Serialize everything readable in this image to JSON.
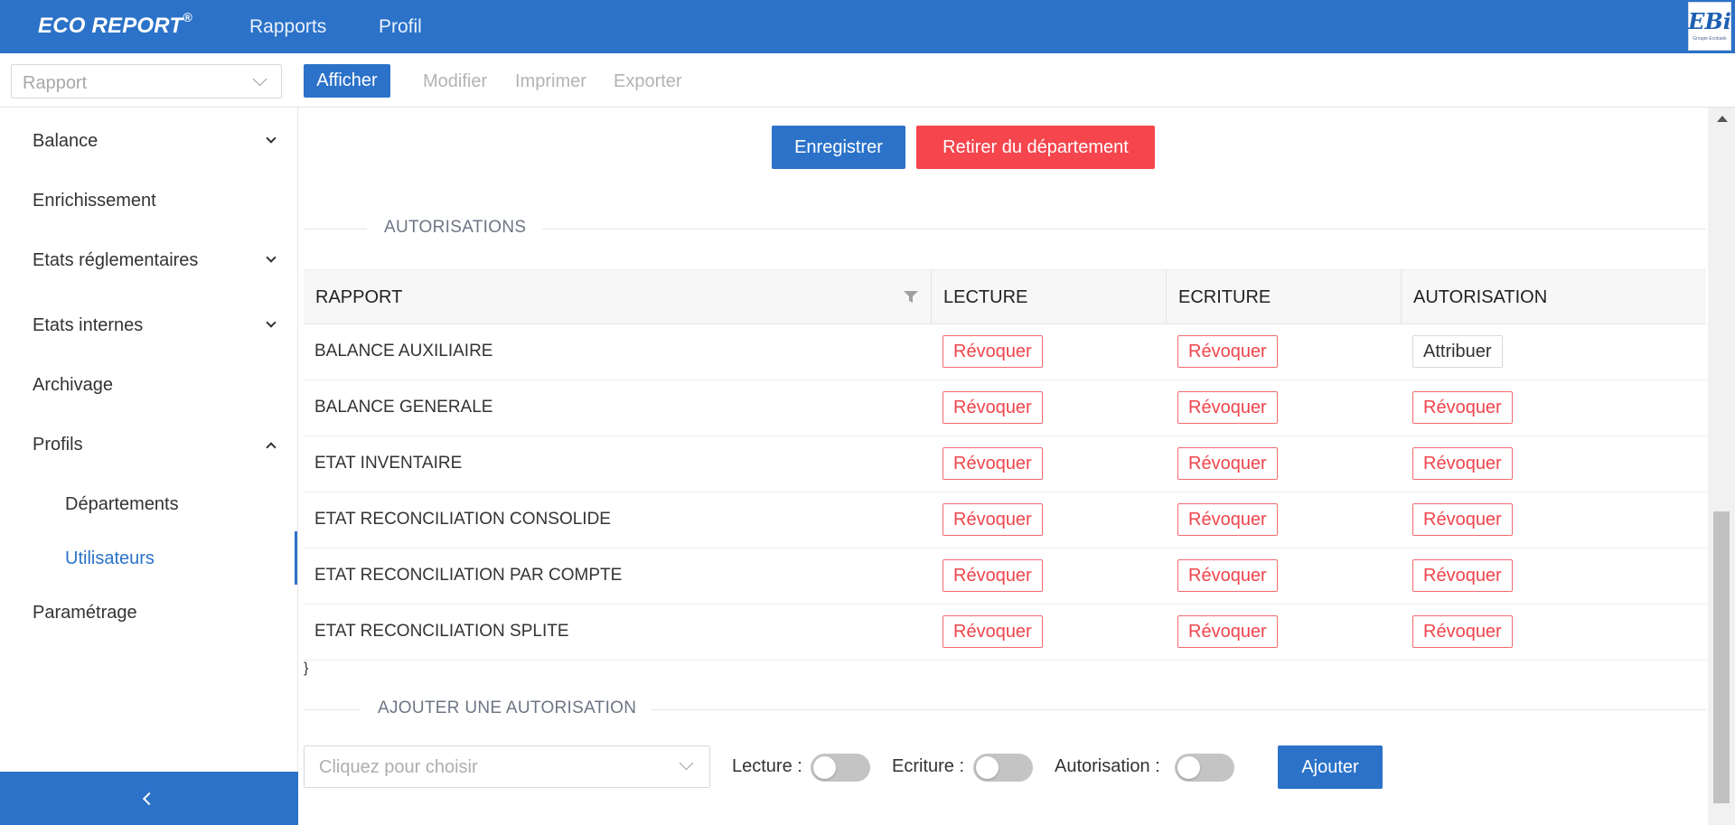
{
  "header": {
    "brand": "ECO REPORT",
    "brand_mark": "®",
    "nav": [
      "Rapports",
      "Profil"
    ],
    "logo_text": "EBi",
    "logo_sub": "Groupe Ecobank"
  },
  "toolbar": {
    "report_placeholder": "Rapport",
    "afficher_label": "Afficher",
    "modifier_label": "Modifier",
    "imprimer_label": "Imprimer",
    "exporter_label": "Exporter"
  },
  "sidebar": {
    "items": [
      {
        "label": "Balance",
        "has_children": true,
        "expanded": false
      },
      {
        "label": "Enrichissement",
        "has_children": false
      },
      {
        "label": "Etats réglementaires",
        "has_children": true,
        "expanded": false
      },
      {
        "label": "Etats internes",
        "has_children": true,
        "expanded": false
      },
      {
        "label": "Archivage",
        "has_children": false
      },
      {
        "label": "Profils",
        "has_children": true,
        "expanded": true
      },
      {
        "label": "Paramétrage",
        "has_children": false
      }
    ],
    "profils_children": [
      {
        "label": "Départements",
        "active": false
      },
      {
        "label": "Utilisateurs",
        "active": true
      }
    ]
  },
  "main": {
    "enregistrer_label": "Enregistrer",
    "retirer_label": "Retirer du département",
    "autorisations_title": "AUTORISATIONS",
    "table": {
      "columns": [
        "RAPPORT",
        "LECTURE",
        "ECRITURE",
        "AUTORISATION"
      ],
      "rows": [
        {
          "rapport": "BALANCE AUXILIAIRE",
          "lecture": "Révoquer",
          "ecriture": "Révoquer",
          "autorisation": "Attribuer"
        },
        {
          "rapport": "BALANCE GENERALE",
          "lecture": "Révoquer",
          "ecriture": "Révoquer",
          "autorisation": "Révoquer"
        },
        {
          "rapport": "ETAT INVENTAIRE",
          "lecture": "Révoquer",
          "ecriture": "Révoquer",
          "autorisation": "Révoquer"
        },
        {
          "rapport": "ETAT RECONCILIATION CONSOLIDE",
          "lecture": "Révoquer",
          "ecriture": "Révoquer",
          "autorisation": "Révoquer"
        },
        {
          "rapport": "ETAT RECONCILIATION PAR COMPTE",
          "lecture": "Révoquer",
          "ecriture": "Révoquer",
          "autorisation": "Révoquer"
        },
        {
          "rapport": "ETAT RECONCILIATION SPLITE",
          "lecture": "Révoquer",
          "ecriture": "Révoquer",
          "autorisation": "Révoquer"
        }
      ]
    },
    "add_title": "AJOUTER UNE AUTORISATION",
    "add_placeholder": "Cliquez pour choisir",
    "toggles": [
      {
        "label": "Lecture :",
        "on": false
      },
      {
        "label": "Ecriture :",
        "on": false
      },
      {
        "label": "Autorisation :",
        "on": false
      }
    ],
    "ajouter_label": "Ajouter"
  },
  "colors": {
    "primary": "#2b72c8",
    "danger": "#f5454d",
    "revoke_text": "#f0444c"
  }
}
